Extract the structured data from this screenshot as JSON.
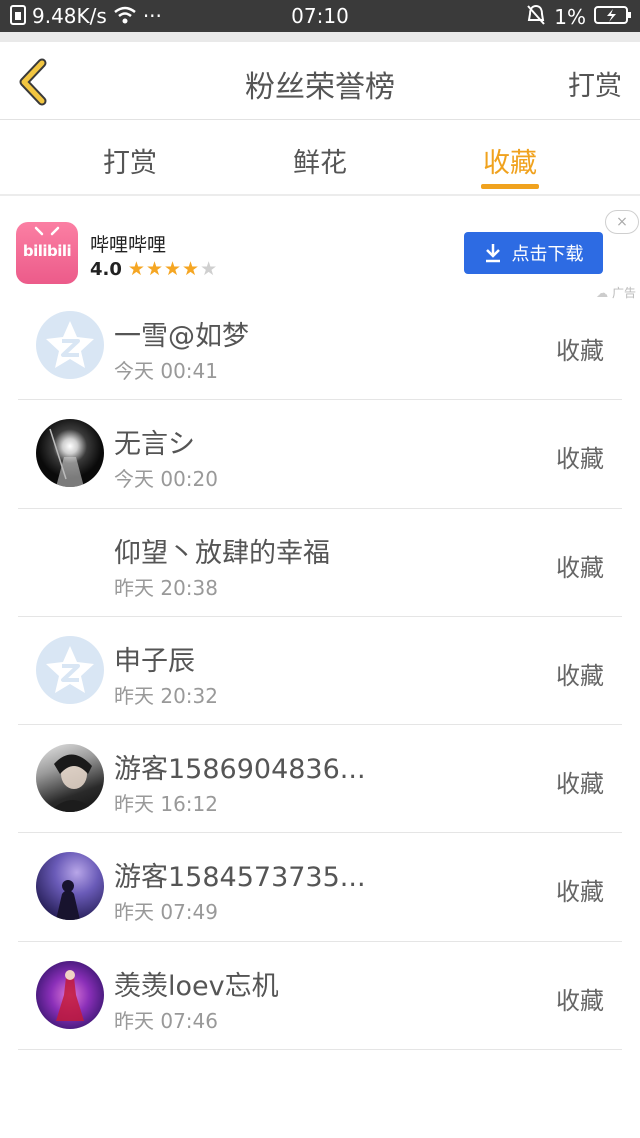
{
  "status_bar": {
    "speed": "9.48K/s",
    "dots": "···",
    "time": "07:10",
    "battery": "1%"
  },
  "header": {
    "title": "粉丝荣誉榜",
    "right_link": "打赏"
  },
  "tabs": [
    {
      "label": "打赏",
      "active": false
    },
    {
      "label": "鲜花",
      "active": false
    },
    {
      "label": "收藏",
      "active": true
    }
  ],
  "ad": {
    "logo_text": "bilibili",
    "app_name": "哔哩哔哩",
    "rating": "4.0",
    "stars_filled": 4,
    "stars_total": 5,
    "download_label": "点击下载",
    "close_label": "×",
    "tag": "广告"
  },
  "list": [
    {
      "name": "一雪@如梦",
      "time": "今天 00:41",
      "action": "收藏",
      "avatar": "qq-default"
    },
    {
      "name": "无言シ",
      "time": "今天 00:20",
      "action": "收藏",
      "avatar": "dark-photo"
    },
    {
      "name": "仰望丶放肆的幸福",
      "time": "昨天 20:38",
      "action": "收藏",
      "avatar": "blank"
    },
    {
      "name": "申子辰",
      "time": "昨天 20:32",
      "action": "收藏",
      "avatar": "qq-default"
    },
    {
      "name": "游客1586904836...",
      "time": "昨天 16:12",
      "action": "收藏",
      "avatar": "photo-gray"
    },
    {
      "name": "游客1584573735...",
      "time": "昨天 07:49",
      "action": "收藏",
      "avatar": "photo-purple"
    },
    {
      "name": "羡羡loev忘机",
      "time": "昨天 07:46",
      "action": "收藏",
      "avatar": "photo-violet"
    }
  ],
  "colors": {
    "accent": "#f0a21e",
    "download_button": "#2d6be3",
    "status_bar": "#3a3a3a"
  }
}
